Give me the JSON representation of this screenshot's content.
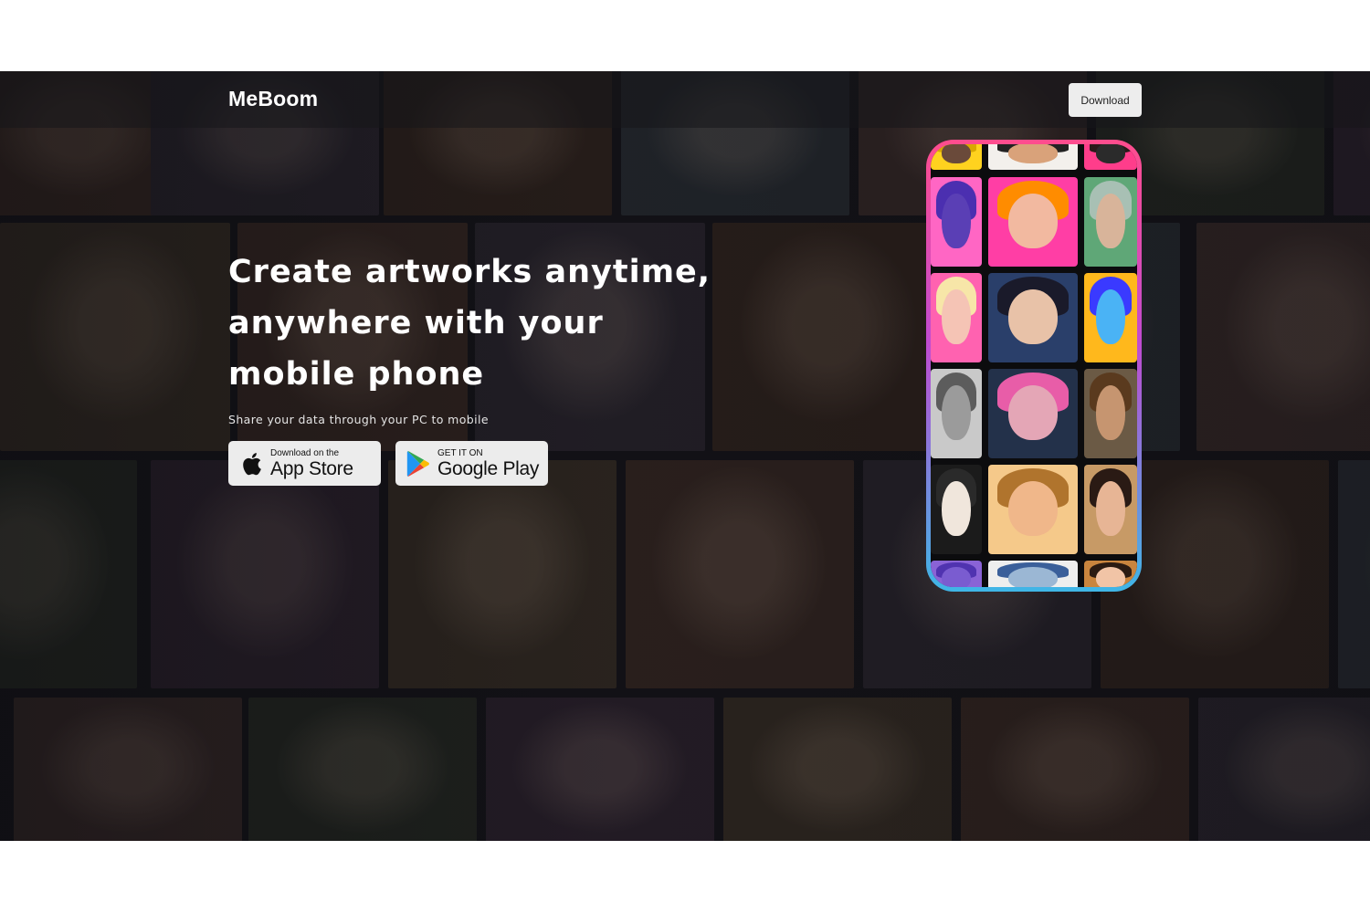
{
  "header": {
    "brand": "MeBoom",
    "download_label": "Download"
  },
  "hero": {
    "headline": "Create artworks anytime, anywhere with your mobile phone",
    "subline": "Share your data through your PC to mobile"
  },
  "stores": {
    "apple": {
      "small": "Download on the",
      "big": "App Store",
      "icon": "apple-icon"
    },
    "google": {
      "small": "GET IT ON",
      "big": "Google Play",
      "icon": "google-play-icon"
    }
  },
  "colors": {
    "phone_frame_top": "#ff4d8d",
    "phone_frame_bottom": "#3fb6e6",
    "button_bg": "#ececec"
  }
}
